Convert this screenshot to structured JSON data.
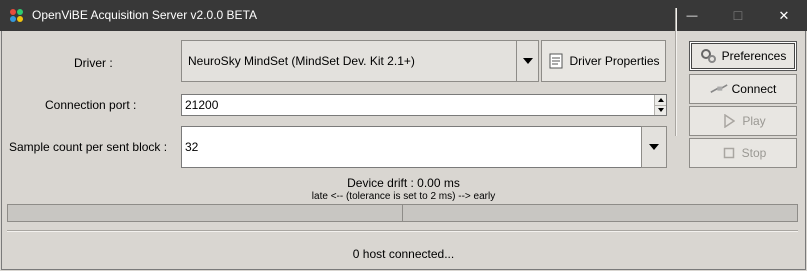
{
  "window": {
    "title": "OpenViBE Acquisition Server v2.0.0 BETA",
    "minimize_glyph": "—",
    "maximize_glyph": "☐",
    "close_glyph": "✕"
  },
  "form": {
    "driver_label": "Driver :",
    "driver_value": "NeuroSky MindSet (MindSet Dev. Kit 2.1+)",
    "driver_properties_label": "Driver Properties",
    "port_label": "Connection port :",
    "port_value": "21200",
    "sample_label": "Sample count per sent block :",
    "sample_value": "32"
  },
  "actions": {
    "preferences": "Preferences",
    "connect": "Connect",
    "play": "Play",
    "stop": "Stop"
  },
  "drift": {
    "title": "Device drift : 0.00 ms",
    "tolerance": "late <-- (tolerance is set to 2 ms) --> early",
    "value_ms": 0.0,
    "tolerance_ms": 2
  },
  "status": {
    "text": "0 host connected..."
  },
  "colors": {
    "titlebar": "#383838",
    "window_bg": "#d9d6d1",
    "disabled_text": "#9a9893"
  },
  "icons": [
    "openvibe-logo-icon",
    "chevron-down-icon",
    "properties-icon",
    "preferences-icon",
    "connect-icon",
    "play-icon",
    "stop-icon",
    "spin-up-icon",
    "spin-down-icon"
  ]
}
